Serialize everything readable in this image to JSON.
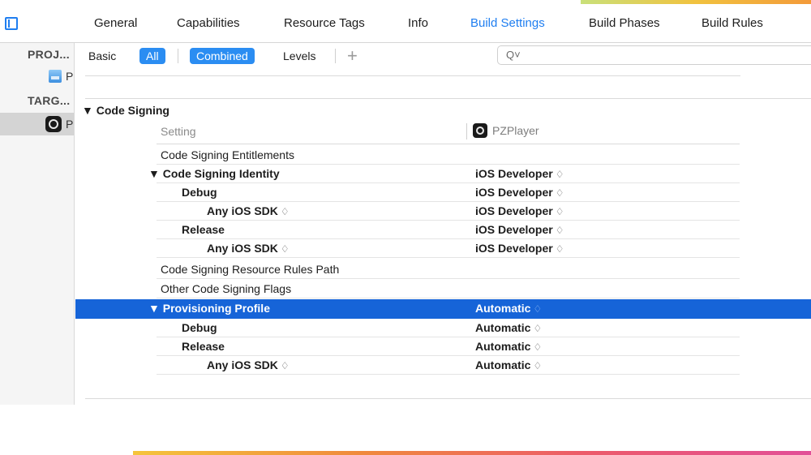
{
  "tabs": [
    {
      "label": "General"
    },
    {
      "label": "Capabilities"
    },
    {
      "label": "Resource Tags"
    },
    {
      "label": "Info"
    },
    {
      "label": "Build Settings",
      "active": true
    },
    {
      "label": "Build Phases"
    },
    {
      "label": "Build Rules"
    }
  ],
  "navigator": {
    "project_header": "PROJ...",
    "project_item": "P",
    "targets_header": "TARG...",
    "target_item": "P"
  },
  "filters": {
    "basic": "Basic",
    "all": "All",
    "combined": "Combined",
    "levels": "Levels",
    "add": "+",
    "search_placeholder": "Q˅"
  },
  "section": {
    "title": "▼ Code Signing",
    "col_setting": "Setting",
    "col_target": "PZPlayer"
  },
  "rows": [
    {
      "name": "Code Signing Entitlements",
      "value": ""
    },
    {
      "name": "▼ Code Signing Identity",
      "value": "iOS Developer"
    },
    {
      "name": "Debug",
      "value": "iOS Developer"
    },
    {
      "name": "Any iOS SDK",
      "value": "iOS Developer"
    },
    {
      "name": "Release",
      "value": "iOS Developer"
    },
    {
      "name": "Any iOS SDK",
      "value": "iOS Developer"
    },
    {
      "name": "Code Signing Resource Rules Path",
      "value": ""
    },
    {
      "name": "Other Code Signing Flags",
      "value": ""
    },
    {
      "name": "▼ Provisioning Profile",
      "value": "Automatic"
    },
    {
      "name": "Debug",
      "value": "Automatic"
    },
    {
      "name": "Release",
      "value": "Automatic"
    },
    {
      "name": "Any iOS SDK",
      "value": "Automatic"
    }
  ],
  "stepper_glyph": "♢",
  "colors": {
    "accent": "#1f7ef0",
    "selection": "#1664d8",
    "pill": "#2b8df2"
  }
}
